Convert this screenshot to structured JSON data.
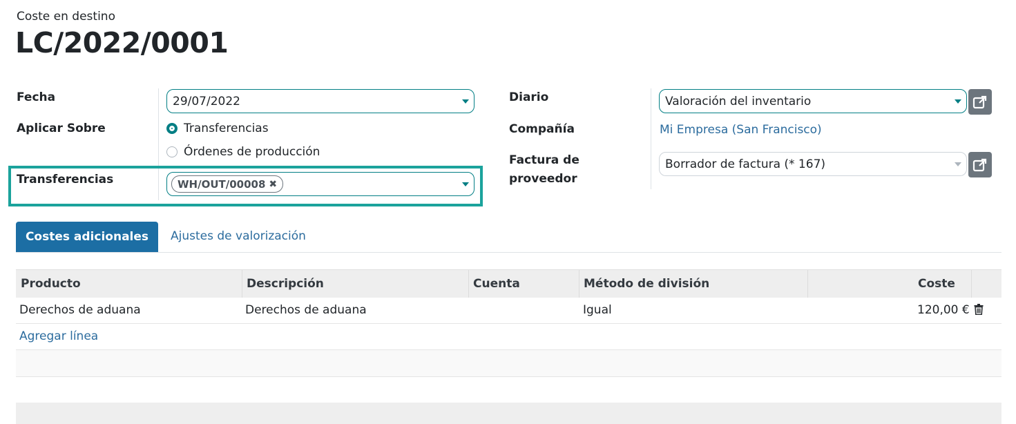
{
  "header": {
    "subtitle": "Coste en destino",
    "title": "LC/2022/0001"
  },
  "form": {
    "fecha": {
      "label": "Fecha",
      "value": "29/07/2022"
    },
    "aplicar_sobre": {
      "label": "Aplicar Sobre",
      "options": [
        {
          "label": "Transferencias",
          "selected": true
        },
        {
          "label": "Órdenes de producción",
          "selected": false
        }
      ]
    },
    "transferencias": {
      "label": "Transferencias",
      "tags": [
        "WH/OUT/00008"
      ],
      "remove_icon": "close-icon"
    },
    "diario": {
      "label": "Diario",
      "value": "Valoración del inventario"
    },
    "compania": {
      "label": "Compañía",
      "value": "Mi Empresa (San Francisco)"
    },
    "factura": {
      "label_line1": "Factura de",
      "label_line2": "proveedor",
      "value": "Borrador de factura (* 167)"
    },
    "external_link_icon": "external-link-icon"
  },
  "tabs": [
    {
      "label": "Costes adicionales",
      "active": true
    },
    {
      "label": "Ajustes de valorización",
      "active": false
    }
  ],
  "table": {
    "columns": [
      "Producto",
      "Descripción",
      "Cuenta",
      "Método de división",
      "Coste"
    ],
    "rows": [
      {
        "producto": "Derechos de aduana",
        "descripcion": "Derechos de aduana",
        "cuenta": "",
        "metodo": "Igual",
        "coste": "120,00 €"
      }
    ],
    "add_line": "Agregar línea",
    "delete_icon": "trash-icon"
  },
  "colors": {
    "primary": "#017e84",
    "tab_active": "#1c6ea4",
    "link": "#2c6c9e",
    "highlight": "#1ba39c"
  }
}
